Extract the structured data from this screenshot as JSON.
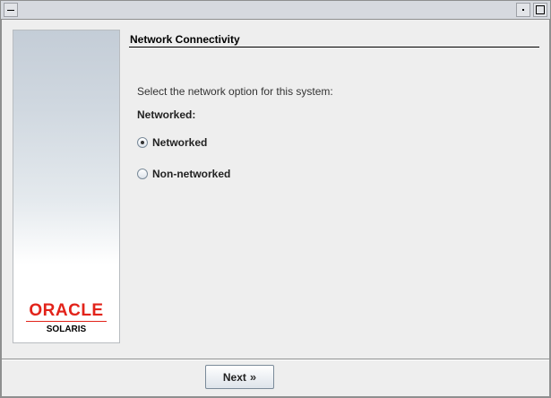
{
  "title": "Network Connectivity",
  "instructions": "Select the network option for this system:",
  "group_label": "Networked:",
  "options": [
    {
      "label": "Networked",
      "selected": true
    },
    {
      "label": "Non-networked",
      "selected": false
    }
  ],
  "branding": {
    "logo_text": "ORACLE",
    "product": "SOLARIS",
    "logo_color": "#e2231a"
  },
  "footer": {
    "next_label": "Next",
    "next_icon": "double-chevron-right-icon"
  }
}
